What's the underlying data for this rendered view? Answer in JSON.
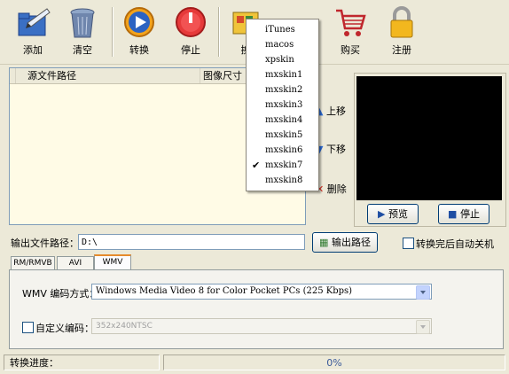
{
  "toolbar": {
    "add": "添加",
    "clear": "清空",
    "convert": "转换",
    "stop": "停止",
    "skin": "换",
    "buy": "购买",
    "register": "注册"
  },
  "file_list": {
    "columns": [
      "源文件路径",
      "图像尺寸"
    ]
  },
  "side_buttons": {
    "move_up": "上移",
    "move_down": "下移",
    "delete": "删除"
  },
  "preview": {
    "preview_button": "预览",
    "stop_button": "停止"
  },
  "output": {
    "label": "输出文件路径：",
    "value": "D:\\",
    "browse_button": "输出路径",
    "shutdown_label": "转换完后自动关机",
    "shutdown_checked": false
  },
  "tabs": [
    "RM/RMVB",
    "AVI",
    "WMV"
  ],
  "active_tab": "WMV",
  "wmv": {
    "encoding_label": "WMV 编码方式：",
    "encoding_value": "Windows Media Video 8 for Color Pocket PCs (225 Kbps)",
    "custom_label": "自定义编码：",
    "custom_checked": false,
    "custom_value": "352x240NTSC"
  },
  "status": {
    "label": "转换进度：",
    "progress_text": "0%",
    "progress_fraction": 0
  },
  "skin_menu": {
    "items": [
      "iTunes",
      "macos",
      "xpskin",
      "mxskin1",
      "mxskin2",
      "mxskin3",
      "mxskin4",
      "mxskin5",
      "mxskin6",
      "mxskin7",
      "mxskin8"
    ],
    "checked": "mxskin7"
  },
  "colors": {
    "preview_bg": "#000000",
    "list_bg": "#fffbe6",
    "window_bg": "#ece9d8",
    "tab_highlight": "#e68b2c"
  }
}
